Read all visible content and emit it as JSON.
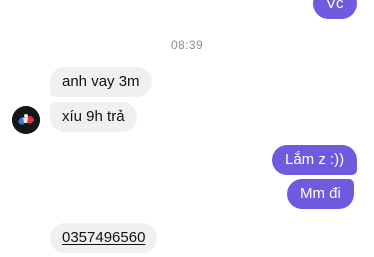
{
  "conversation": {
    "timestamp": "08:39",
    "messages": [
      {
        "id": "m1",
        "direction": "outgoing",
        "text": "Vc"
      },
      {
        "id": "m2",
        "direction": "incoming",
        "text": "anh vay 3m"
      },
      {
        "id": "m3",
        "direction": "incoming",
        "text": "xíu 9h trả"
      },
      {
        "id": "m4",
        "direction": "outgoing",
        "text": "Lắm z :))"
      },
      {
        "id": "m5",
        "direction": "outgoing",
        "text": "Mm đi"
      },
      {
        "id": "m6",
        "direction": "incoming",
        "text": "0357496560",
        "is_link": true
      }
    ]
  },
  "colors": {
    "outgoing_bubble": "#6e5be0",
    "incoming_bubble": "#f0f0f0",
    "timestamp_text": "#8e8e93"
  },
  "icons": {
    "sender_avatar": "avatar-icon"
  }
}
